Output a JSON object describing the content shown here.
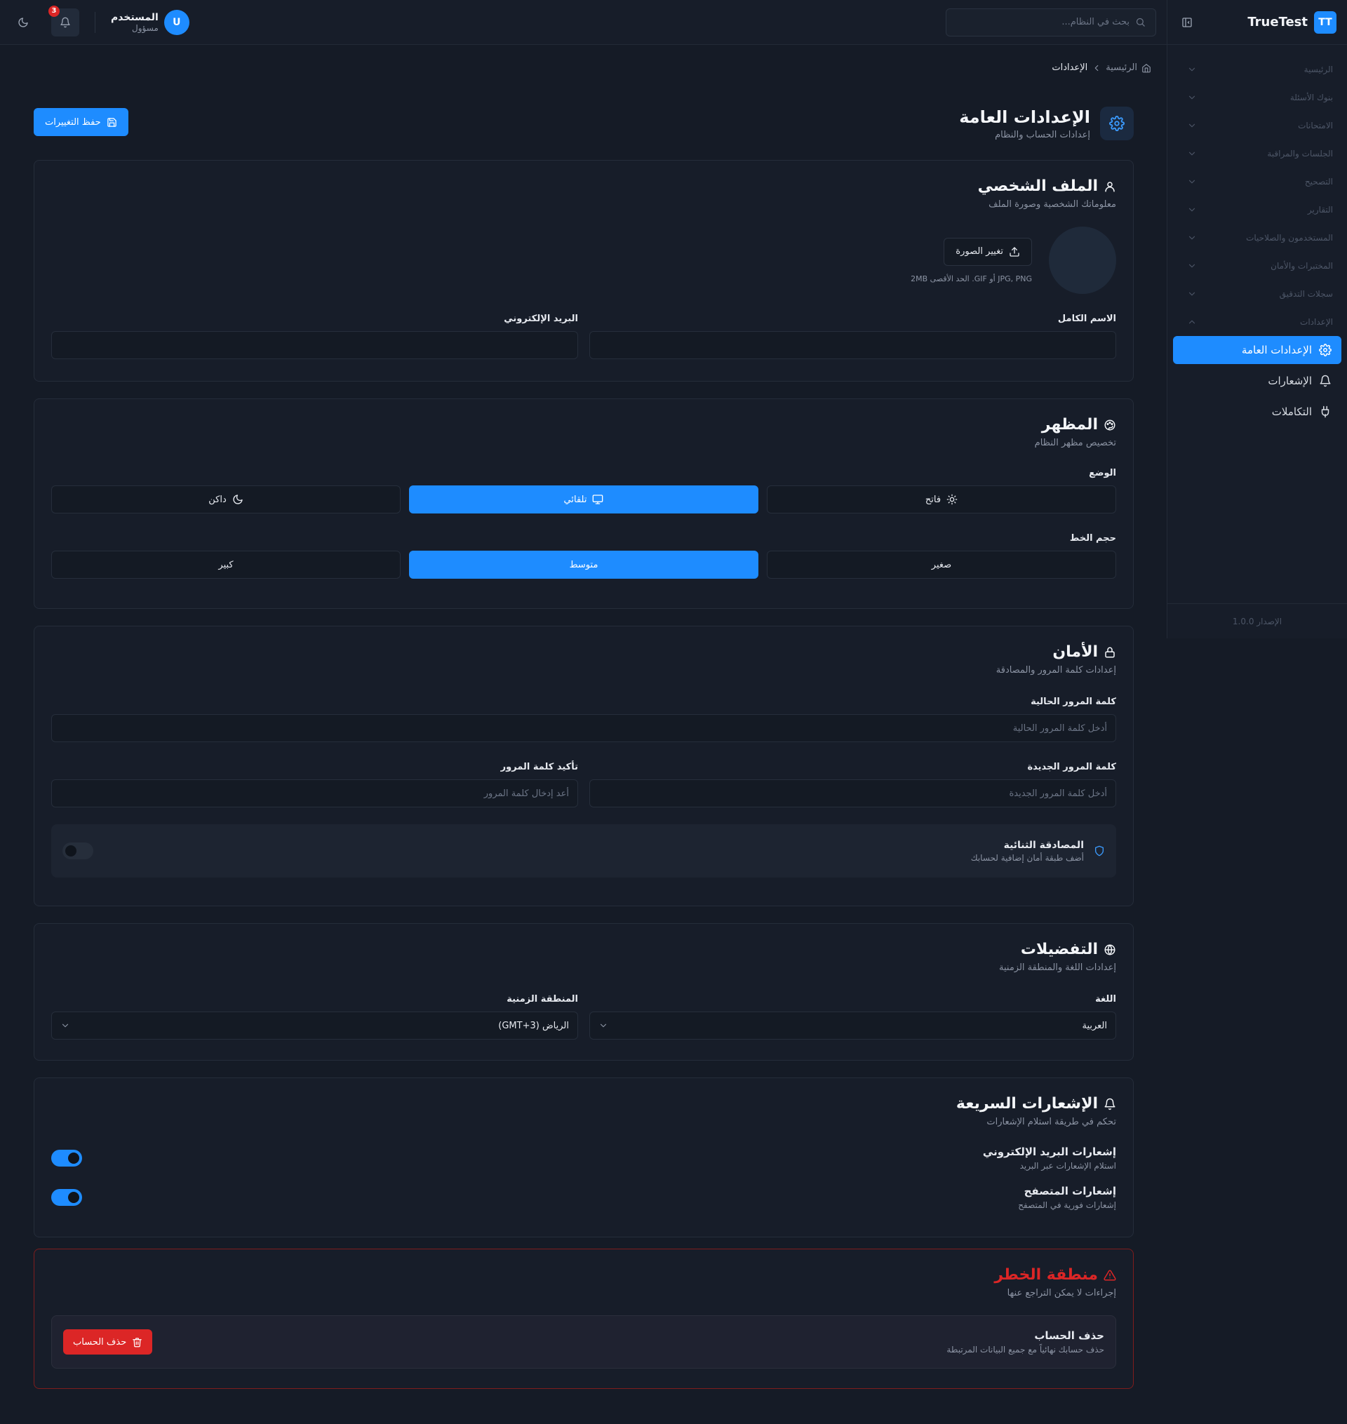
{
  "app": {
    "logo": "TT",
    "name": "TrueTest",
    "version": "الإصدار 1.0.0"
  },
  "header": {
    "search_placeholder": "بحث في النظام...",
    "notification_count": "3",
    "user_initial": "U",
    "user_name": "المستخدم",
    "user_role": "مسؤول"
  },
  "sidebar": {
    "items": [
      {
        "label": "الرئيسية"
      },
      {
        "label": "بنوك الأسئلة"
      },
      {
        "label": "الامتحانات"
      },
      {
        "label": "الجلسات والمراقبة"
      },
      {
        "label": "التصحيح"
      },
      {
        "label": "التقارير"
      },
      {
        "label": "المستخدمون والصلاحيات"
      },
      {
        "label": "المختبرات والأمان"
      },
      {
        "label": "سجلات التدقيق"
      },
      {
        "label": "الإعدادات"
      }
    ],
    "subitems": [
      {
        "label": "الإعدادات العامة",
        "icon": "gear-icon",
        "active": true
      },
      {
        "label": "الإشعارات",
        "icon": "bell-icon",
        "active": false
      },
      {
        "label": "التكاملات",
        "icon": "plug-icon",
        "active": false
      }
    ]
  },
  "breadcrumb": {
    "home": "الرئيسية",
    "current": "الإعدادات"
  },
  "page": {
    "title": "الإعدادات العامة",
    "subtitle": "إعدادات الحساب والنظام",
    "save_label": "حفظ التغييرات"
  },
  "profile": {
    "title": "الملف الشخصي",
    "subtitle": "معلوماتك الشخصية وصورة الملف",
    "change_photo": "تغيير الصورة",
    "photo_hint": "JPG, PNG أو GIF. الحد الأقصى 2MB",
    "full_name_label": "الاسم الكامل",
    "full_name_value": "",
    "email_label": "البريد الإلكتروني",
    "email_value": ""
  },
  "appearance": {
    "title": "المظهر",
    "subtitle": "تخصيص مظهر النظام",
    "mode_label": "الوضع",
    "modes": [
      "فاتح",
      "تلقائي",
      "داكن"
    ],
    "mode_selected": "تلقائي",
    "font_label": "حجم الخط",
    "font_sizes": [
      "صغير",
      "متوسط",
      "كبير"
    ],
    "font_selected": "متوسط"
  },
  "security": {
    "title": "الأمان",
    "subtitle": "إعدادات كلمة المرور والمصادقة",
    "current_label": "كلمة المرور الحالية",
    "current_placeholder": "أدخل كلمة المرور الحالية",
    "new_label": "كلمة المرور الجديدة",
    "new_placeholder": "أدخل كلمة المرور الجديدة",
    "confirm_label": "تأكيد كلمة المرور",
    "confirm_placeholder": "أعد إدخال كلمة المرور",
    "twofa_title": "المصادقة الثنائية",
    "twofa_sub": "أضف طبقة أمان إضافية لحسابك",
    "twofa_enabled": false
  },
  "preferences": {
    "title": "التفضيلات",
    "subtitle": "إعدادات اللغة والمنطقة الزمنية",
    "language_label": "اللغة",
    "language_value": "العربية",
    "timezone_label": "المنطقة الزمنية",
    "timezone_value": "الرياض (GMT+3)"
  },
  "quick_notifications": {
    "title": "الإشعارات السريعة",
    "subtitle": "تحكم في طريقة استلام الإشعارات",
    "items": [
      {
        "title": "إشعارات البريد الإلكتروني",
        "sub": "استلام الإشعارات عبر البريد",
        "enabled": true
      },
      {
        "title": "إشعارات المتصفح",
        "sub": "إشعارات فورية في المتصفح",
        "enabled": true
      }
    ]
  },
  "danger": {
    "title": "منطقة الخطر",
    "subtitle": "إجراءات لا يمكن التراجع عنها",
    "delete_title": "حذف الحساب",
    "delete_sub": "حذف حسابك نهائياً مع جميع البيانات المرتبطة",
    "delete_button": "حذف الحساب"
  },
  "colors": {
    "accent": "#1e8cff",
    "danger": "#dc2626",
    "background": "#151b26",
    "card": "#171d29"
  }
}
